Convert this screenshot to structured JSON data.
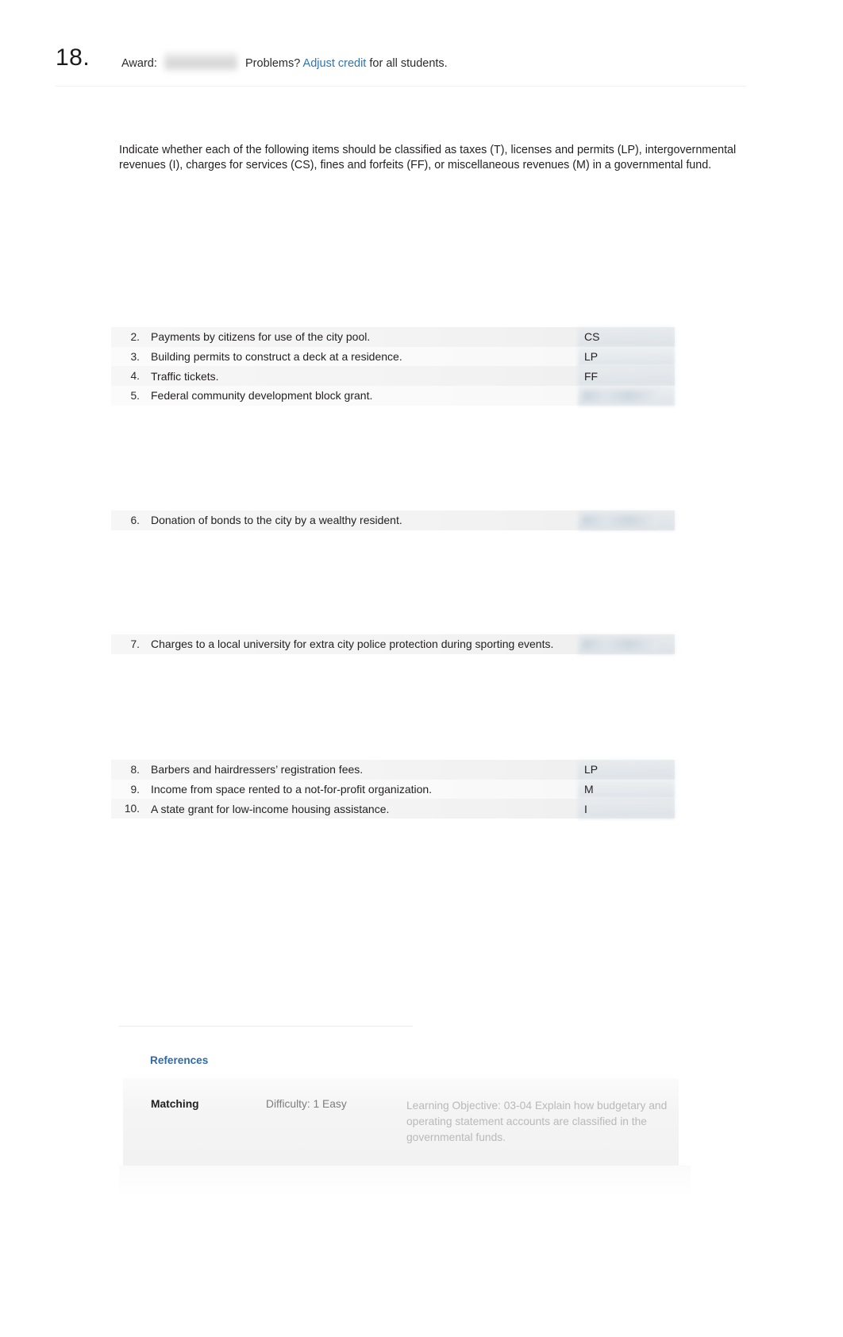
{
  "header": {
    "question_number": "18.",
    "award_label": "Award:",
    "award_value_redacted": "",
    "problems_prefix": "Problems?",
    "adjust_credit_link": "Adjust credit",
    "problems_suffix": "for all students."
  },
  "instructions": "Indicate whether each of the following items should be classified as taxes (T), licenses and permits (LP), intergovernmental revenues (I), charges for services (CS), fines and forfeits (FF), or miscellaneous revenues (M) in a governmental fund.",
  "groups": [
    {
      "rows": [
        {
          "num": "2.",
          "text": "Payments by citizens for use of the city pool.",
          "answer": "CS",
          "redacted": false
        },
        {
          "num": "3.",
          "text": "Building permits to construct a deck at a residence.",
          "answer": "LP",
          "redacted": false
        },
        {
          "num": "4.",
          "text": "Traffic tickets.",
          "answer": "FF",
          "redacted": false
        },
        {
          "num": "5.",
          "text": "Federal community development block grant.",
          "answer": "",
          "redacted": true
        }
      ]
    },
    {
      "rows": [
        {
          "num": "6.",
          "text": "Donation of bonds to the city by a wealthy resident.",
          "answer": "",
          "redacted": true
        }
      ]
    },
    {
      "rows": [
        {
          "num": "7.",
          "text": "Charges to a local university for extra city police protection during sporting events.",
          "answer": "",
          "redacted": true
        }
      ]
    },
    {
      "rows": [
        {
          "num": "8.",
          "text": "Barbers and hairdressers’ registration fees.",
          "answer": "LP",
          "redacted": false
        },
        {
          "num": "9.",
          "text": "Income from space rented to a not-for-profit organization.",
          "answer": "M",
          "redacted": false
        },
        {
          "num": "10.",
          "text": "A state grant for low-income housing assistance.",
          "answer": "I",
          "redacted": false
        }
      ]
    }
  ],
  "footer": {
    "references_label": "References",
    "question_type": "Matching",
    "difficulty": "Difficulty: 1 Easy",
    "learning_objective": "Learning Objective: 03-04 Explain how budgetary and operating statement accounts are classified in the governmental funds."
  },
  "colors": {
    "link": "#2f74b5",
    "references": "#2f6aa8",
    "text": "#231f20",
    "muted": "#7d7d7d",
    "faint": "#b9b9b9"
  }
}
